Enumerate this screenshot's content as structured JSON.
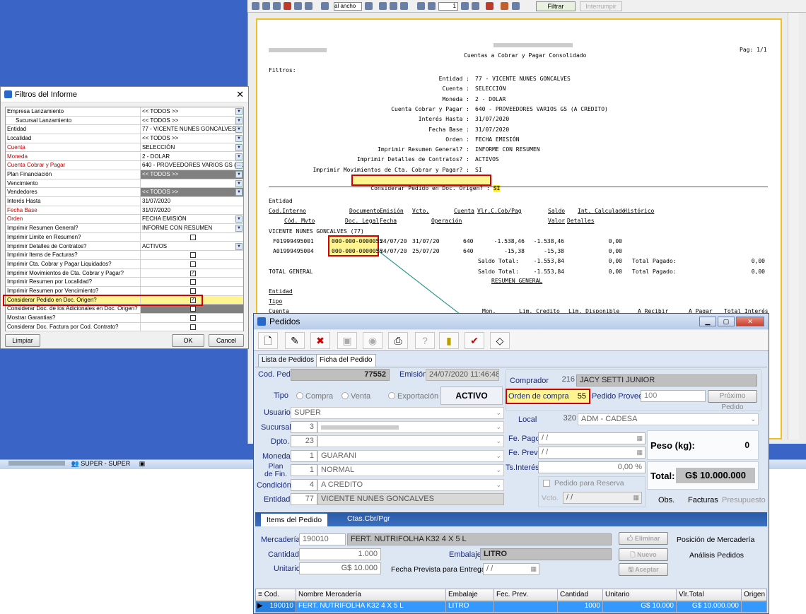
{
  "taskbar": {
    "user": "SUPER - SUPER"
  },
  "report": {
    "zoom": "al ancho",
    "page_input": "1",
    "filter_button": "Filtrar",
    "interrupt_button": "Interrumpir",
    "subtitle": "Cuentas a Cobrar y Pagar Consolidado",
    "page": "Pag: 1/1",
    "filters_title": "Filtros:",
    "filters": [
      {
        "label": "Entidad :",
        "value": "77 - VICENTE NUNES GONCALVES"
      },
      {
        "label": "Cuenta :",
        "value": "SELECCIÓN"
      },
      {
        "label": "Moneda :",
        "value": "2 - DOLAR"
      },
      {
        "label": "Cuenta Cobrar y Pagar :",
        "value": "640 - PROVEEDORES VARIOS GS (A CREDITO)"
      },
      {
        "label": "Interés Hasta :",
        "value": "31/07/2020"
      },
      {
        "label": "Fecha Base :",
        "value": "31/07/2020"
      },
      {
        "label": "Orden :",
        "value": "FECHA EMISIÓN"
      },
      {
        "label": "Imprimir Resumen General? :",
        "value": "INFORME CON RESUMEN"
      },
      {
        "label": "Imprimir Detalles de Contratos? :",
        "value": "ACTIVOS"
      },
      {
        "label": "Imprimir Movimientos de Cta. Cobrar y Pagar? :",
        "value": "SI"
      }
    ],
    "highlight_filter": {
      "label": "Considerar Pedido en Doc. Origen? :",
      "value": "SI"
    },
    "headers": {
      "entidad": "Entidad",
      "cod_interno": "Cod.Interno",
      "documento": "Documento",
      "emision": "Emisión",
      "vcto": "Vcto.",
      "cuenta": "Cuenta",
      "vlr": "Vlr.C.Cob/Pag",
      "saldo": "Saldo",
      "int": "Int. Calculado",
      "historico": "Histórico",
      "cod_mvto": "Cód. Mvto",
      "doc_legal": "Doc. Legal",
      "fecha": "Fecha",
      "operacion": "Operación",
      "valor": "Valor",
      "detalles": "Detalles"
    },
    "entity_line": "VICENTE NUNES GONCALVES (77)",
    "rows": [
      {
        "cod": "F01999495001",
        "doc": "000-000-0000055",
        "emision": "24/07/20",
        "vcto": "31/07/20",
        "cuenta": "640",
        "vlr": "-1.538,46",
        "saldo": "-1.538,46",
        "int": "0,00"
      },
      {
        "cod": "A01999495004",
        "doc": "000-000-0000055",
        "emision": "24/07/20",
        "vcto": "25/07/20",
        "cuenta": "640",
        "vlr": "-15,38",
        "saldo": "-15,38",
        "int": "0,00"
      }
    ],
    "saldo_total_label": "Saldo Total:",
    "saldo_total": "-1.553,84",
    "int_total": "0,00",
    "total_pagado_label": "Total Pagado:",
    "total_pagado": "0,00",
    "total_general": "TOTAL GENERAL",
    "resumen": "RESUMEN GENERAL",
    "summary_headers": {
      "entidad": "Entidad",
      "tipo": "Tipo",
      "cuenta": "Cuenta",
      "mon": "Mon.",
      "lim_credito": "Lim. Credito",
      "lim_disp": "Lim. Disponible",
      "a_recibir": "A Recibir",
      "a_pagar": "A Pagar",
      "total_int": "Total Interés"
    }
  },
  "filter_dialog": {
    "title": "Filtros del Informe",
    "rows": [
      {
        "label": "Empresa Lanzamiento",
        "value": "<< TODOS >>",
        "type": "dd"
      },
      {
        "label": "Sucursal Lanzamiento",
        "value": "<< TODOS >>",
        "type": "dd"
      },
      {
        "label": "Entidad",
        "value": "77 - VICENTE NUNES GONCALVES",
        "type": "dd"
      },
      {
        "label": "Localidad",
        "value": "<< TODOS >>",
        "type": "dd"
      },
      {
        "label": "Cuenta",
        "value": "SELECCIÓN",
        "type": "dd",
        "red": true
      },
      {
        "label": "Moneda",
        "value": "2 - DOLAR",
        "type": "dd",
        "red": true
      },
      {
        "label": "Cuenta Cobrar y Pagar",
        "value": "640 - PROVEEDORES VARIOS GS (A CR",
        "type": "dots",
        "red": true
      },
      {
        "label": "Plan Financiación",
        "value": "<< TODOS >>",
        "type": "dd",
        "gray": true
      },
      {
        "label": "Vencimiento",
        "value": "",
        "type": "dd"
      },
      {
        "label": "Vendedores",
        "value": "<< TODOS >>",
        "type": "dd",
        "gray": true
      },
      {
        "label": "Interés Hasta",
        "value": "31/07/2020",
        "type": "none"
      },
      {
        "label": "Fecha Base",
        "value": "31/07/2020",
        "type": "none",
        "red": true
      },
      {
        "label": "Orden",
        "value": "FECHA EMISIÓN",
        "type": "dd",
        "red": true
      },
      {
        "label": "Imprimir Resumen General?",
        "value": "INFORME CON RESUMEN",
        "type": "dd"
      },
      {
        "label": "Imprimir Limite en Resumen?",
        "value": "",
        "type": "chk"
      },
      {
        "label": "Imprimir Detalles de Contratos?",
        "value": "ACTIVOS",
        "type": "dd"
      },
      {
        "label": "Imprimir Items de Facturas?",
        "value": "",
        "type": "chk"
      },
      {
        "label": "Imprimir Cta. Cobrar y Pagar Liquidados?",
        "value": "",
        "type": "chk"
      },
      {
        "label": "Imprimir Movimientos de Cta. Cobrar y Pagar?",
        "value": "✓",
        "type": "chk"
      },
      {
        "label": "Imprimir Resumen por Localidad?",
        "value": "",
        "type": "chk"
      },
      {
        "label": "Imprimir Resumen por Vencimiento?",
        "value": "",
        "type": "chk"
      },
      {
        "label": "Considerar Pedido en Doc. Origen?",
        "value": "✓",
        "type": "chk",
        "highlight": true
      },
      {
        "label": "Considerar Doc. de los Adicionales en Doc. Origen?",
        "value": "",
        "type": "chk",
        "gray": true
      },
      {
        "label": "Mostrar Garantias?",
        "value": "",
        "type": "chk"
      },
      {
        "label": "Considerar Doc. Factura por Cod. Contrato?",
        "value": "",
        "type": "chk"
      }
    ],
    "limpiar": "Limpiar",
    "ok": "OK",
    "cancel": "Cancel"
  },
  "pedidos": {
    "title": "Pedidos",
    "tabs": [
      "Lista de Pedidos",
      "Ficha del Pedido"
    ],
    "cod_ped_label": "Cod. Ped.",
    "cod_ped": "77552",
    "emision_label": "Emisión",
    "emision": "24/07/2020 11:46:48",
    "tipo_label": "Tipo",
    "tipo_options": [
      "Compra",
      "Venta",
      "Exportación"
    ],
    "estado": "ACTIVO",
    "comprador_label": "Comprador",
    "comprador_code": "216",
    "comprador": "JACY SETTI JUNIOR",
    "orden_compra_label": "Orden de compra",
    "orden_compra": "55",
    "pedido_prov_label": "Pedido Proveedor",
    "pedido_prov": "100",
    "proximo_pedido": "Próximo Pedido",
    "usuario_label": "Usuario",
    "usuario": "SUPER",
    "sucursal_label": "Sucursal",
    "sucursal_code": "3",
    "dpto_label": "Dpto.",
    "dpto_code": "23",
    "moneda_label": "Moneda",
    "moneda_code": "1",
    "moneda": "GUARANI",
    "plan_label": "Plan de Fin.",
    "plan_code": "1",
    "plan": "NORMAL",
    "condicion_label": "Condición",
    "condicion_code": "4",
    "condicion": "A CREDITO",
    "entidad_label": "Entidad",
    "entidad_code": "77",
    "entidad": "VICENTE NUNES GONCALVES",
    "local_label": "Local",
    "local_code": "320",
    "local": "ADM - CADESA",
    "fe_pago_label": "Fe. Pago",
    "fe_pago": "/ /",
    "fe_prev_label": "Fe. Prev",
    "fe_prev": "/ /",
    "ts_interes_label": "Ts.Interés",
    "ts_interes": "0,00 %",
    "reserva_label": "Pedido para Reserva",
    "vcto_label": "Vcto.",
    "vcto": "/ /",
    "peso_label": "Peso (kg):",
    "peso": "0",
    "total_label": "Total:",
    "total": "G$ 10.000.000",
    "obs": "Obs.",
    "facturas": "Facturas",
    "presupuesto": "Presupuesto",
    "sub_tabs": [
      "Items del Pedido",
      "Ctas.Cbr/Pgr"
    ],
    "mercaderia_label": "Mercadería",
    "mercaderia_code": "190010",
    "mercaderia": "FERT. NUTRIFOLHA K32 4 X 5 L",
    "cantidad_label": "Cantidad",
    "cantidad": "1.000",
    "embalaje_label": "Embalaje",
    "embalaje": "LITRO",
    "unitario_label": "Unitario",
    "unitario": "G$ 10.000",
    "fecha_prevista_label": "Fecha Prevista para Entrega",
    "fecha_prevista": "/ /",
    "eliminar": "Eliminar",
    "nuevo": "Nuevo",
    "aceptar": "Aceptar",
    "posicion": "Posición de Mercadería",
    "analisis": "Análisis Pedidos",
    "grid_headers": [
      "Cod.",
      "Nombre Mercadería",
      "Embalaje",
      "Fec. Prev.",
      "Cantidad",
      "Unitario",
      "Vlr.Total",
      "Origen"
    ],
    "grid_row": [
      "190010",
      "FERT. NUTRIFOLHA K32 4 X 5 L",
      "LITRO",
      "",
      "1000",
      "G$ 10.000",
      "G$ 10.000.000",
      ""
    ]
  },
  "colors": {
    "highlight": "#fff590",
    "box": "#d00000",
    "desktop": "#3a64c6",
    "selected_row": "#3399ff"
  }
}
